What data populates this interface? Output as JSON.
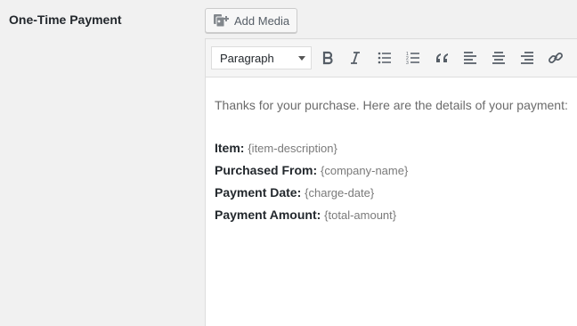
{
  "field": {
    "label": "One-Time Payment"
  },
  "media_button": {
    "label": "Add Media",
    "icon": "add-media-icon"
  },
  "toolbar": {
    "format_select": "Paragraph",
    "buttons": [
      {
        "name": "bold",
        "icon": "bold-icon"
      },
      {
        "name": "italic",
        "icon": "italic-icon"
      },
      {
        "name": "bulleted-list",
        "icon": "bulleted-list-icon"
      },
      {
        "name": "numbered-list",
        "icon": "numbered-list-icon"
      },
      {
        "name": "blockquote",
        "icon": "quote-icon"
      },
      {
        "name": "align-left",
        "icon": "align-left-icon"
      },
      {
        "name": "align-center",
        "icon": "align-center-icon"
      },
      {
        "name": "align-right",
        "icon": "align-right-icon"
      },
      {
        "name": "insert-link",
        "icon": "link-icon"
      }
    ]
  },
  "content": {
    "intro": "Thanks for your purchase. Here are the details of your payment:",
    "rows": [
      {
        "label": "Item:",
        "value": "{item-description}"
      },
      {
        "label": "Purchased From:",
        "value": "{company-name}"
      },
      {
        "label": "Payment Date:",
        "value": "{charge-date}"
      },
      {
        "label": "Payment Amount:",
        "value": "{total-amount}"
      }
    ]
  }
}
